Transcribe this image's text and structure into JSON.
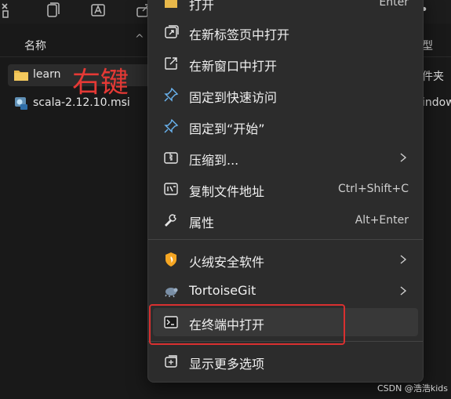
{
  "column_header": {
    "name": "名称",
    "type": "型"
  },
  "files": [
    {
      "name": "learn",
      "type": "件夹",
      "icon": "folder-icon",
      "color": "#e8b84a"
    },
    {
      "name": "scala-2.12.10.msi",
      "type": "indow",
      "icon": "msi-installer-icon"
    }
  ],
  "annotation": "右键",
  "context_menu": {
    "items": [
      {
        "label": "打开",
        "shortcut": "Enter",
        "icon": "folder-open-icon"
      },
      {
        "label": "在新标签页中打开",
        "icon": "new-tab-icon"
      },
      {
        "label": "在新窗口中打开",
        "icon": "new-window-icon"
      },
      {
        "label": "固定到快速访问",
        "icon": "pin-icon"
      },
      {
        "label": "固定到“开始”",
        "icon": "pin-icon"
      },
      {
        "label": "压缩到...",
        "icon": "zip-icon",
        "submenu": true
      },
      {
        "label": "复制文件地址",
        "shortcut": "Ctrl+Shift+C",
        "icon": "copy-path-icon"
      },
      {
        "label": "属性",
        "shortcut": "Alt+Enter",
        "icon": "wrench-icon"
      },
      {
        "label": "火绒安全软件",
        "icon": "shield-icon",
        "submenu": true
      },
      {
        "label": "TortoiseGit",
        "icon": "tortoisegit-icon",
        "submenu": true
      },
      {
        "label": "在终端中打开",
        "icon": "terminal-icon",
        "highlighted": true
      },
      {
        "label": "显示更多选项",
        "icon": "more-options-icon"
      }
    ]
  },
  "toolbar": {
    "more_label": "•••"
  },
  "watermark": "CSDN @浩浩kids",
  "colors": {
    "highlight_red": "#d93030",
    "folder_yellow": "#e8b84a",
    "annotation_red": "#e53935"
  }
}
